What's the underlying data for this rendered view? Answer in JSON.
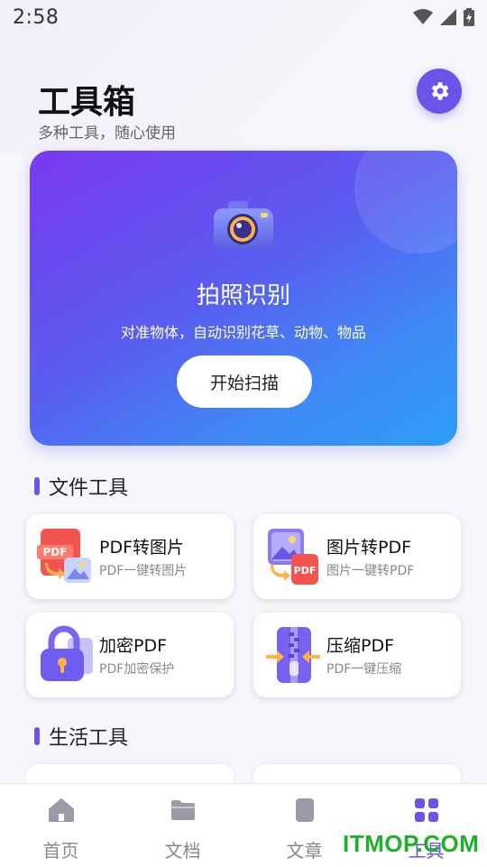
{
  "status": {
    "time": "2:58"
  },
  "header": {
    "title": "工具箱",
    "subtitle": "多种工具，随心使用"
  },
  "hero": {
    "title": "拍照识别",
    "description": "对准物体，自动识别花草、动物、物品",
    "button_label": "开始扫描"
  },
  "sections": [
    {
      "title": "文件工具"
    },
    {
      "title": "生活工具"
    }
  ],
  "file_tools": [
    {
      "title": "PDF转图片",
      "subtitle": "PDF一键转图片",
      "icon": "pdf-to-image-icon"
    },
    {
      "title": "图片转PDF",
      "subtitle": "图片一键转PDF",
      "icon": "image-to-pdf-icon"
    },
    {
      "title": "加密PDF",
      "subtitle": "PDF加密保护",
      "icon": "lock-pdf-icon"
    },
    {
      "title": "压缩PDF",
      "subtitle": "PDF一键压缩",
      "icon": "zip-pdf-icon"
    }
  ],
  "nav": [
    {
      "label": "首页",
      "icon": "home-icon"
    },
    {
      "label": "文档",
      "icon": "folder-icon"
    },
    {
      "label": "文章",
      "icon": "article-icon"
    },
    {
      "label": "工具",
      "icon": "grid-icon"
    }
  ],
  "watermark": "ITMOP.COM",
  "colors": {
    "accent": "#6a55e8",
    "hero_start": "#7a39ee",
    "hero_end": "#2d9df7"
  }
}
